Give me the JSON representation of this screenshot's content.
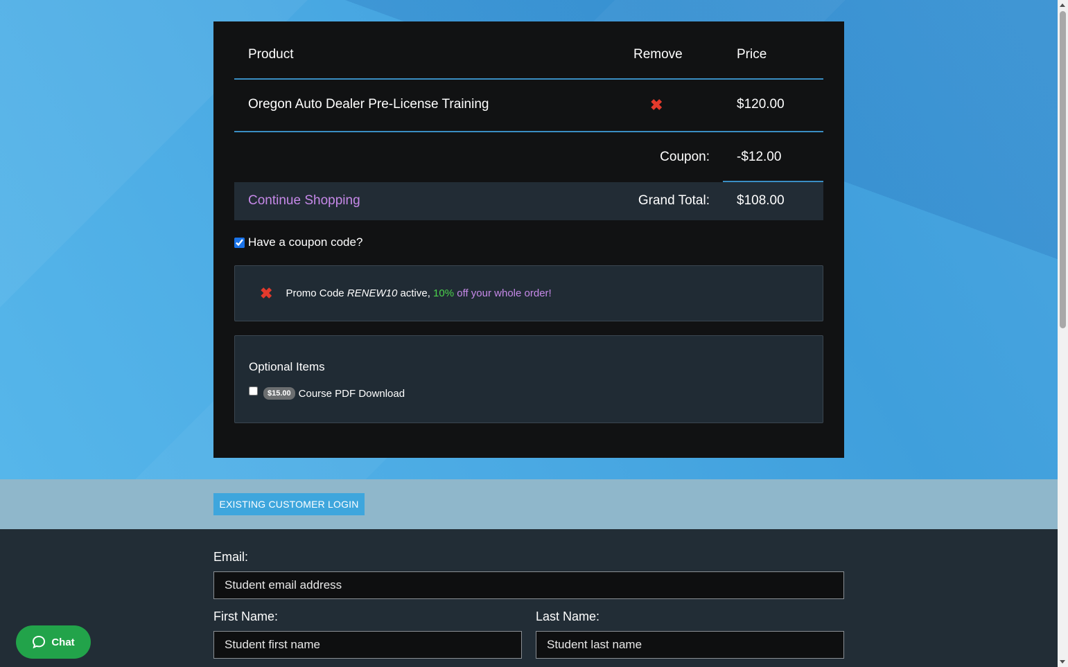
{
  "cart": {
    "headers": {
      "product": "Product",
      "remove": "Remove",
      "price": "Price"
    },
    "item": {
      "name": "Oregon Auto Dealer Pre-License Training",
      "remove_icon": "✖",
      "price": "$120.00"
    },
    "coupon": {
      "label": "Coupon:",
      "amount": "-$12.00"
    },
    "total": {
      "continue": "Continue Shopping",
      "label": "Grand Total:",
      "amount": "$108.00"
    }
  },
  "coupon_question": {
    "label": "Have a coupon code?",
    "checked": true
  },
  "promo": {
    "remove_icon": "✖",
    "prefix": "Promo Code ",
    "code": "RENEW10",
    "middle": " active, ",
    "percent": "10%",
    "suffix": " off your whole order!"
  },
  "optional": {
    "title": "Optional Items",
    "items": [
      {
        "price_badge": "$15.00",
        "label": "Course PDF Download",
        "checked": false
      }
    ]
  },
  "login": {
    "button": "EXISTING CUSTOMER LOGIN"
  },
  "form": {
    "email_label": "Email:",
    "email_placeholder": "Student email address",
    "first_label": "First Name:",
    "first_placeholder": "Student first name",
    "last_label": "Last Name:",
    "last_placeholder": "Student last name"
  },
  "chat": {
    "label": "Chat",
    "icon": "chat-bubble-icon"
  },
  "colors": {
    "accent_blue": "#3ea6dd",
    "remove_red": "#e33a2c",
    "link_purple": "#c689e8",
    "promo_green": "#4cd24c",
    "chat_green": "#22a34a"
  }
}
